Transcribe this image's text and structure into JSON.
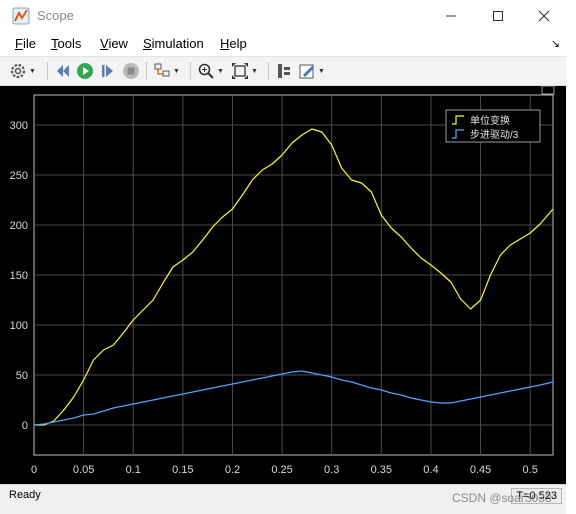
{
  "window": {
    "title": "Scope"
  },
  "menu": [
    {
      "label": "File",
      "accel": "F",
      "rest": "ile"
    },
    {
      "label": "Tools",
      "accel": "T",
      "rest": "ools"
    },
    {
      "label": "View",
      "accel": "V",
      "rest": "iew"
    },
    {
      "label": "Simulation",
      "accel": "S",
      "rest": "imulation"
    },
    {
      "label": "Help",
      "accel": "H",
      "rest": "elp"
    }
  ],
  "toolbar_icons": [
    "settings-icon",
    "step-back-icon",
    "run-icon",
    "step-forward-icon",
    "stop-icon",
    "signal-icon",
    "zoom-icon",
    "autoscale-icon",
    "cursor-icon",
    "style-icon"
  ],
  "colors": {
    "plot_bg": "#000000",
    "axes_bg": "#000000",
    "grid": "#4d4d4d",
    "tick_text": "#d9d9d9",
    "series_1": "#ffff00",
    "series_2": "#4da6ff"
  },
  "status": {
    "text": "Ready",
    "time": "T=0.523"
  },
  "watermark": "CSDN @soar3033",
  "chart_data": {
    "type": "line",
    "title": "",
    "xlabel": "",
    "ylabel": "",
    "xlim": [
      0,
      0.523
    ],
    "ylim": [
      -30,
      330
    ],
    "x_ticks": [
      0,
      0.05,
      0.1,
      0.15,
      0.2,
      0.25,
      0.3,
      0.35,
      0.4,
      0.45,
      0.5
    ],
    "x_tick_labels": [
      "0",
      "0.05",
      "0.1",
      "0.15",
      "0.2",
      "0.25",
      "0.3",
      "0.35",
      "0.4",
      "0.45",
      "0.5"
    ],
    "y_ticks": [
      0,
      50,
      100,
      150,
      200,
      250,
      300
    ],
    "y_tick_labels": [
      "0",
      "50",
      "100",
      "150",
      "200",
      "250",
      "300"
    ],
    "grid": true,
    "legend": "top-right",
    "series": [
      {
        "name": "单位变换",
        "color": "#ffff00",
        "x": [
          0,
          0.01,
          0.02,
          0.03,
          0.04,
          0.05,
          0.06,
          0.07,
          0.08,
          0.09,
          0.1,
          0.11,
          0.12,
          0.13,
          0.14,
          0.15,
          0.16,
          0.17,
          0.18,
          0.19,
          0.2,
          0.21,
          0.22,
          0.23,
          0.24,
          0.25,
          0.26,
          0.27,
          0.28,
          0.29,
          0.3,
          0.31,
          0.32,
          0.33,
          0.34,
          0.35,
          0.36,
          0.37,
          0.38,
          0.39,
          0.4,
          0.41,
          0.42,
          0.43,
          0.44,
          0.45,
          0.46,
          0.47,
          0.48,
          0.49,
          0.5,
          0.51,
          0.523
        ],
        "y": [
          0,
          0,
          4,
          15,
          28,
          45,
          65,
          75,
          80,
          92,
          105,
          115,
          125,
          142,
          158,
          165,
          173,
          185,
          198,
          208,
          216,
          230,
          245,
          255,
          261,
          270,
          282,
          290,
          296,
          293,
          280,
          257,
          245,
          242,
          233,
          210,
          197,
          188,
          177,
          167,
          160,
          152,
          143,
          126,
          116,
          125,
          150,
          170,
          180,
          186,
          192,
          201,
          216
        ]
      },
      {
        "name": "步进驱动/3",
        "color": "#4da6ff",
        "x": [
          0,
          0.01,
          0.02,
          0.03,
          0.04,
          0.05,
          0.06,
          0.07,
          0.08,
          0.09,
          0.1,
          0.11,
          0.12,
          0.13,
          0.14,
          0.15,
          0.16,
          0.17,
          0.18,
          0.19,
          0.2,
          0.21,
          0.22,
          0.23,
          0.24,
          0.25,
          0.26,
          0.27,
          0.28,
          0.29,
          0.3,
          0.31,
          0.32,
          0.33,
          0.34,
          0.35,
          0.36,
          0.37,
          0.38,
          0.39,
          0.4,
          0.41,
          0.42,
          0.43,
          0.44,
          0.45,
          0.46,
          0.47,
          0.48,
          0.49,
          0.5,
          0.51,
          0.523
        ],
        "y": [
          0,
          1,
          3,
          5,
          7,
          10,
          11,
          14,
          17,
          19,
          21,
          23,
          25,
          27,
          29,
          31,
          33,
          35,
          37,
          39,
          41,
          43,
          45,
          47,
          49,
          51,
          53,
          54,
          52,
          50,
          48,
          45,
          43,
          40,
          37,
          35,
          32,
          30,
          27,
          25,
          23,
          22,
          22,
          24,
          26,
          28,
          30,
          32,
          34,
          36,
          38,
          40,
          43
        ]
      }
    ]
  }
}
